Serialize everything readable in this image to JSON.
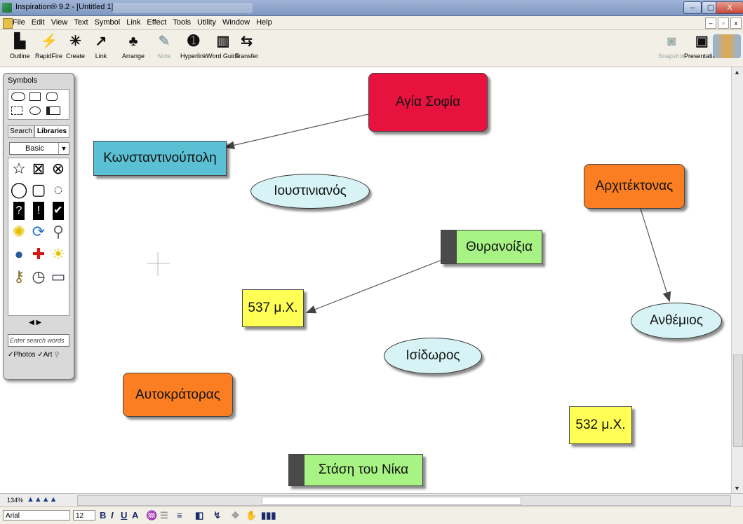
{
  "window": {
    "title": "Inspiration® 9.2 - [Untitled 1]",
    "min": "–",
    "max": "▢",
    "close": "X"
  },
  "menu": [
    "File",
    "Edit",
    "View",
    "Text",
    "Symbol",
    "Link",
    "Effect",
    "Tools",
    "Utility",
    "Window",
    "Help"
  ],
  "mdi_buttons": [
    "–",
    "▫",
    "x"
  ],
  "toolbar": [
    {
      "label": "Outline",
      "icon": "outline-icon",
      "glyph": "▙"
    },
    {
      "label": "RapidFire",
      "icon": "rapidfire-icon",
      "glyph": "⚡"
    },
    {
      "label": "Create",
      "icon": "create-icon",
      "glyph": "✳"
    },
    {
      "label": "Link",
      "icon": "link-icon",
      "glyph": "↗"
    },
    {
      "label": "Arrange",
      "icon": "arrange-icon",
      "glyph": "♣"
    },
    {
      "label": "Note",
      "icon": "note-icon",
      "glyph": "✎"
    },
    {
      "label": "Hyperlink",
      "icon": "hyperlink-icon",
      "glyph": "➊"
    },
    {
      "label": "Word Guide",
      "icon": "word-guide-icon",
      "glyph": "▥"
    },
    {
      "label": "Transfer",
      "icon": "transfer-icon",
      "glyph": "⇆"
    },
    {
      "label": "Snapshot",
      "icon": "snapshot-icon",
      "glyph": "◙"
    },
    {
      "label": "Presentation",
      "icon": "presentation-icon",
      "glyph": "▣"
    }
  ],
  "palette": {
    "title": "Symbols",
    "tabs": [
      "Search",
      "Libraries"
    ],
    "library": "Basic",
    "search_placeholder": "Enter search words",
    "checks": [
      "Photos",
      "Art"
    ]
  },
  "nodes": [
    {
      "id": "agia-sofia",
      "text": "Αγία Σοφία",
      "color": "#e8123f"
    },
    {
      "id": "konstantinoupoli",
      "text": "Κωνσταντινούπολη",
      "color": "#5bc0d3"
    },
    {
      "id": "ioustinianos",
      "text": "Ιουστινιανός",
      "color": "#d7f3f5"
    },
    {
      "id": "architektonas",
      "text": "Αρχιτέκτονας",
      "color": "#fb7f22"
    },
    {
      "id": "thyranoixia",
      "text": "Θυρανοίξια",
      "color": "#a7f383"
    },
    {
      "id": "537",
      "text": "537 μ.Χ.",
      "color": "#ffff55"
    },
    {
      "id": "anthemios",
      "text": "Ανθέμιος",
      "color": "#d7f3f5"
    },
    {
      "id": "isidoros",
      "text": "Ισίδωρος",
      "color": "#d7f3f5"
    },
    {
      "id": "autokratoras",
      "text": "Αυτοκράτορας",
      "color": "#fb7f22"
    },
    {
      "id": "532",
      "text": "532 μ.Χ.",
      "color": "#ffff55"
    },
    {
      "id": "stasi-nika",
      "text": "Στάση του Νίκα",
      "color": "#a7f383"
    }
  ],
  "zoom": "134%",
  "format": {
    "font": "Arial",
    "size": "12"
  }
}
